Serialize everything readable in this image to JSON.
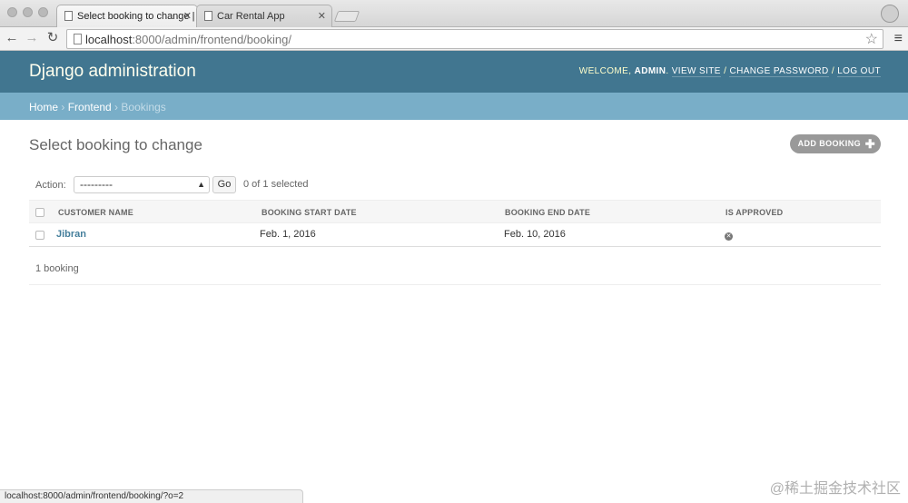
{
  "browser": {
    "tabs": [
      {
        "title": "Select booking to change |",
        "active": true
      },
      {
        "title": "Car Rental App",
        "active": false
      }
    ],
    "url_host": "localhost",
    "url_path": ":8000/admin/frontend/booking/",
    "status_url": "localhost:8000/admin/frontend/booking/?o=2"
  },
  "header": {
    "brand": "Django administration",
    "welcome": "Welcome,",
    "username": "admin",
    "view_site": "View site",
    "change_password": "Change password",
    "logout": "Log out",
    "sep": "/"
  },
  "breadcrumbs": {
    "home": "Home",
    "app": "Frontend",
    "current": "Bookings"
  },
  "page": {
    "title": "Select booking to change",
    "add_button": "Add booking"
  },
  "actions": {
    "label": "Action:",
    "selected_value": "---------",
    "go_label": "Go",
    "selection_count": "0 of 1 selected"
  },
  "table": {
    "columns": [
      "Customer name",
      "Booking start date",
      "Booking end date",
      "Is approved"
    ],
    "rows": [
      {
        "customer_name": "Jibran",
        "start_date": "Feb. 1, 2016",
        "end_date": "Feb. 10, 2016",
        "is_approved": false
      }
    ]
  },
  "paginator": "1 booking",
  "watermark": "@稀土掘金技术社区",
  "colors": {
    "header": "#417690",
    "breadcrumbs": "#79aec8",
    "link": "#447e9b"
  }
}
